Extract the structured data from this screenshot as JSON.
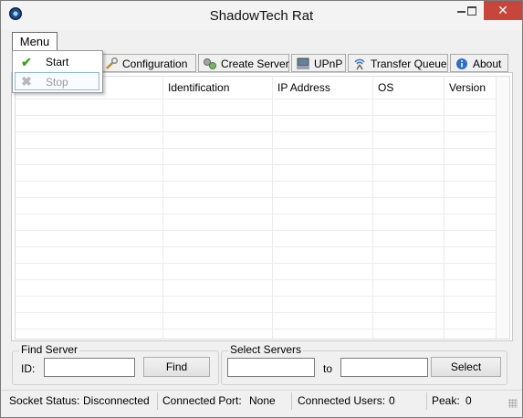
{
  "window": {
    "title": "ShadowTech Rat",
    "buttons": {
      "minimize": "minimize",
      "maximize": "maximize",
      "close": "✕"
    }
  },
  "menubar": {
    "menu_label": "Menu"
  },
  "menu_dropdown": {
    "items": [
      {
        "label": "Start",
        "icon": "check-icon",
        "enabled": true
      },
      {
        "label": "Stop",
        "icon": "x-icon",
        "enabled": false
      }
    ]
  },
  "tabs": [
    {
      "label": "Configuration",
      "icon": "wrench-icon"
    },
    {
      "label": "Create Server",
      "icon": "gears-icon"
    },
    {
      "label": "UPnP",
      "icon": "network-icon"
    },
    {
      "label": "Transfer Queue",
      "icon": "antenna-icon"
    },
    {
      "label": "About",
      "icon": "info-icon"
    }
  ],
  "table": {
    "columns": [
      "Identification",
      "IP Address",
      "OS",
      "Version"
    ],
    "rows": []
  },
  "find_server": {
    "title": "Find Server",
    "id_label": "ID:",
    "id_value": "",
    "button": "Find"
  },
  "select_servers": {
    "title": "Select Servers",
    "from_value": "",
    "to_label": "to",
    "to_value": "",
    "button": "Select"
  },
  "status": {
    "socket_label": "Socket Status:",
    "socket_value": "Disconnected",
    "port_label": "Connected Port:",
    "port_value": "None",
    "users_label": "Connected Users:",
    "users_value": "0",
    "peak_label": "Peak:",
    "peak_value": "0"
  },
  "colors": {
    "close_button": "#c7453a",
    "check": "#3fa320",
    "stop_highlight": "#8fb9d9"
  }
}
